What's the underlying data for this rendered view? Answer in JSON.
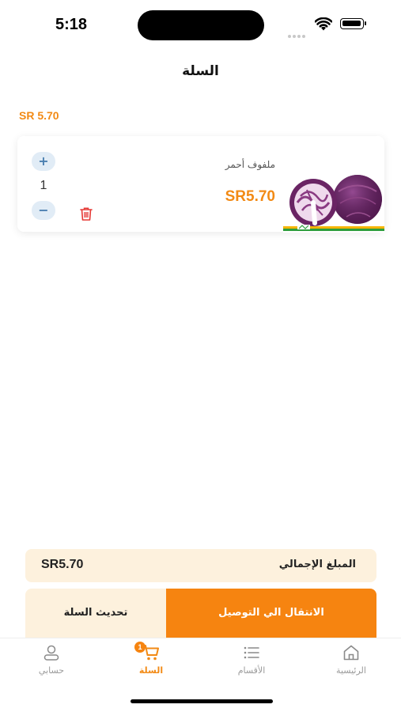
{
  "status_bar": {
    "time": "5:18"
  },
  "header": {
    "title": "السلة"
  },
  "cart_total_top": "SR 5.70",
  "cart_items": [
    {
      "name": "ملفوف أحمر",
      "price": "SR5.70",
      "quantity": "1",
      "plus_label": "+",
      "minus_label": "−"
    }
  ],
  "summary": {
    "label": "المبلغ الإجمالي",
    "value": "SR5.70"
  },
  "actions": {
    "update_label": "تحديث السلة",
    "checkout_label": "الانتقال الي التوصيل"
  },
  "tabs": [
    {
      "label": "حسابي",
      "icon": "user-icon"
    },
    {
      "label": "السلة",
      "icon": "cart-icon",
      "badge": "1",
      "active": true
    },
    {
      "label": "الأقسام",
      "icon": "list-icon"
    },
    {
      "label": "الرئيسية",
      "icon": "home-icon"
    }
  ],
  "colors": {
    "accent": "#f68410",
    "accent_text": "#f28a15",
    "summary_bg": "#fdf1dd",
    "qty_btn_bg": "#e1ecf6",
    "delete_red": "#e53935"
  }
}
